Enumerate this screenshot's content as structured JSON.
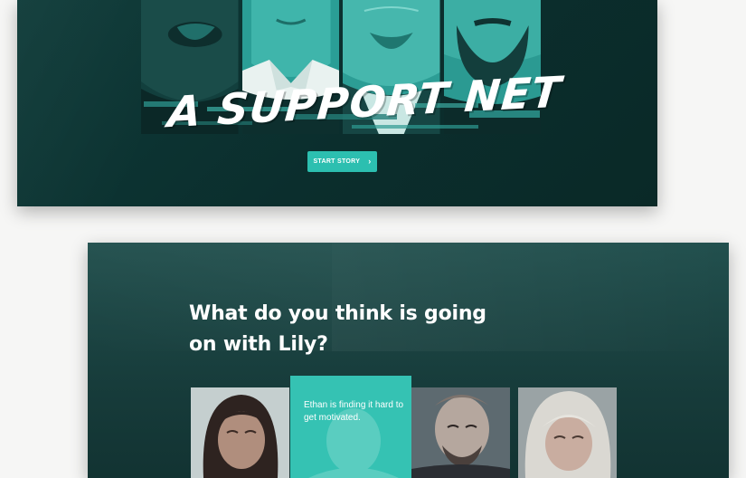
{
  "hero": {
    "title": "A SUPPORT NET",
    "button_label": "START STORY",
    "button_icon": "chevron-right-icon",
    "accent_color": "#2cbfb0",
    "background_color": "#0b2e2d"
  },
  "question": {
    "title": "What do you think is going on with Lily?",
    "choices": [
      {
        "label": "",
        "portrait": "young-woman"
      },
      {
        "label": "Ethan is finding it hard to get motivated.",
        "portrait": "young-man",
        "highlighted": true
      },
      {
        "label": "",
        "portrait": "bald-bearded-man"
      },
      {
        "label": "",
        "portrait": "elderly-woman"
      }
    ],
    "highlight_color": "#35c2b3"
  }
}
